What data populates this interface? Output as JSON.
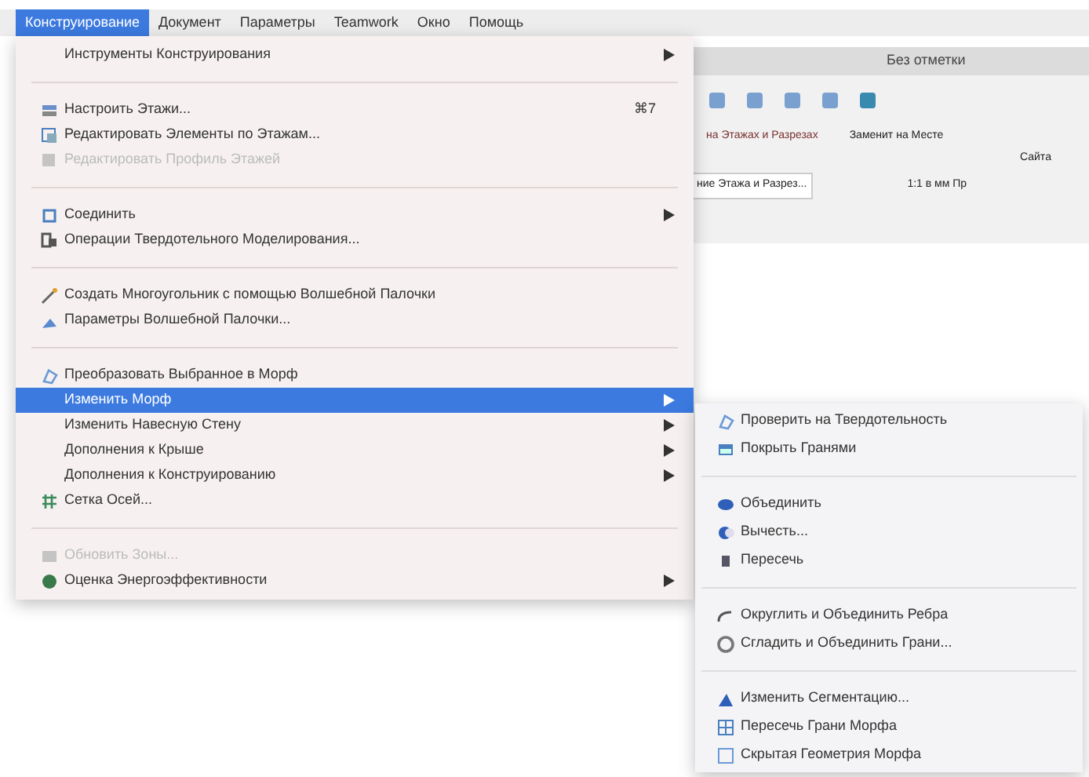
{
  "menubar": [
    {
      "label": "Конструирование",
      "selected": true
    },
    {
      "label": "Документ",
      "selected": false
    },
    {
      "label": "Параметры",
      "selected": false
    },
    {
      "label": "Teamwork",
      "selected": false
    },
    {
      "label": "Окно",
      "selected": false
    },
    {
      "label": "Помощь",
      "selected": false
    }
  ],
  "background": {
    "story_label": "Без отметки",
    "texts": [
      "на Этажах и Разрезах",
      "ние Этажа и Разрез...",
      "Заменит на Месте",
      "Сайта",
      "1:1 в мм Пр"
    ]
  },
  "menu": [
    {
      "kind": "item",
      "label": "Инструменты Конструирования",
      "submenu": true,
      "disabled": false,
      "selected": false
    },
    {
      "kind": "separator"
    },
    {
      "kind": "item",
      "label": "Настроить Этажи...",
      "shortcut": "⌘7",
      "submenu": false,
      "disabled": false,
      "selected": false
    },
    {
      "kind": "item",
      "label": "Редактировать Элементы по Этажам...",
      "submenu": false,
      "disabled": false,
      "selected": false
    },
    {
      "kind": "item",
      "label": "Редактировать Профиль Этажей",
      "submenu": false,
      "disabled": true,
      "selected": false
    },
    {
      "kind": "separator"
    },
    {
      "kind": "item",
      "label": "Соединить",
      "submenu": true,
      "disabled": false,
      "selected": false
    },
    {
      "kind": "item",
      "label": "Операции Твердотельного Моделирования...",
      "submenu": false,
      "disabled": false,
      "selected": false
    },
    {
      "kind": "separator"
    },
    {
      "kind": "item",
      "label": "Создать Многоугольник с помощью Волшебной Палочки",
      "submenu": false,
      "disabled": false,
      "selected": false
    },
    {
      "kind": "item",
      "label": "Параметры Волшебной Палочки...",
      "submenu": false,
      "disabled": false,
      "selected": false
    },
    {
      "kind": "separator"
    },
    {
      "kind": "item",
      "label": "Преобразовать Выбранное в Морф",
      "submenu": false,
      "disabled": false,
      "selected": false
    },
    {
      "kind": "item",
      "label": "Изменить Морф",
      "submenu": true,
      "disabled": false,
      "selected": true
    },
    {
      "kind": "item",
      "label": "Изменить Навесную Стену",
      "submenu": true,
      "disabled": false,
      "selected": false
    },
    {
      "kind": "item",
      "label": "Дополнения к Крыше",
      "submenu": true,
      "disabled": false,
      "selected": false
    },
    {
      "kind": "item",
      "label": "Дополнения к Конструированию",
      "submenu": true,
      "disabled": false,
      "selected": false
    },
    {
      "kind": "item",
      "label": "Сетка Осей...",
      "submenu": false,
      "disabled": false,
      "selected": false
    },
    {
      "kind": "separator"
    },
    {
      "kind": "item",
      "label": "Обновить Зоны...",
      "submenu": false,
      "disabled": true,
      "selected": false
    },
    {
      "kind": "item",
      "label": "Оценка Энергоэффективности",
      "submenu": true,
      "disabled": false,
      "selected": false
    }
  ],
  "submenu": [
    {
      "kind": "item",
      "label": "Проверить на Твердотельность"
    },
    {
      "kind": "item",
      "label": "Покрыть Гранями"
    },
    {
      "kind": "separator"
    },
    {
      "kind": "item",
      "label": "Объединить"
    },
    {
      "kind": "item",
      "label": "Вычесть..."
    },
    {
      "kind": "item",
      "label": "Пересечь"
    },
    {
      "kind": "separator"
    },
    {
      "kind": "item",
      "label": "Округлить и Объединить Ребра"
    },
    {
      "kind": "item",
      "label": "Сгладить и Объединить Грани..."
    },
    {
      "kind": "separator"
    },
    {
      "kind": "item",
      "label": "Изменить Сегментацию..."
    },
    {
      "kind": "item",
      "label": "Пересечь Грани Морфа"
    },
    {
      "kind": "item",
      "label": "Скрытая Геометрия Морфа"
    }
  ]
}
